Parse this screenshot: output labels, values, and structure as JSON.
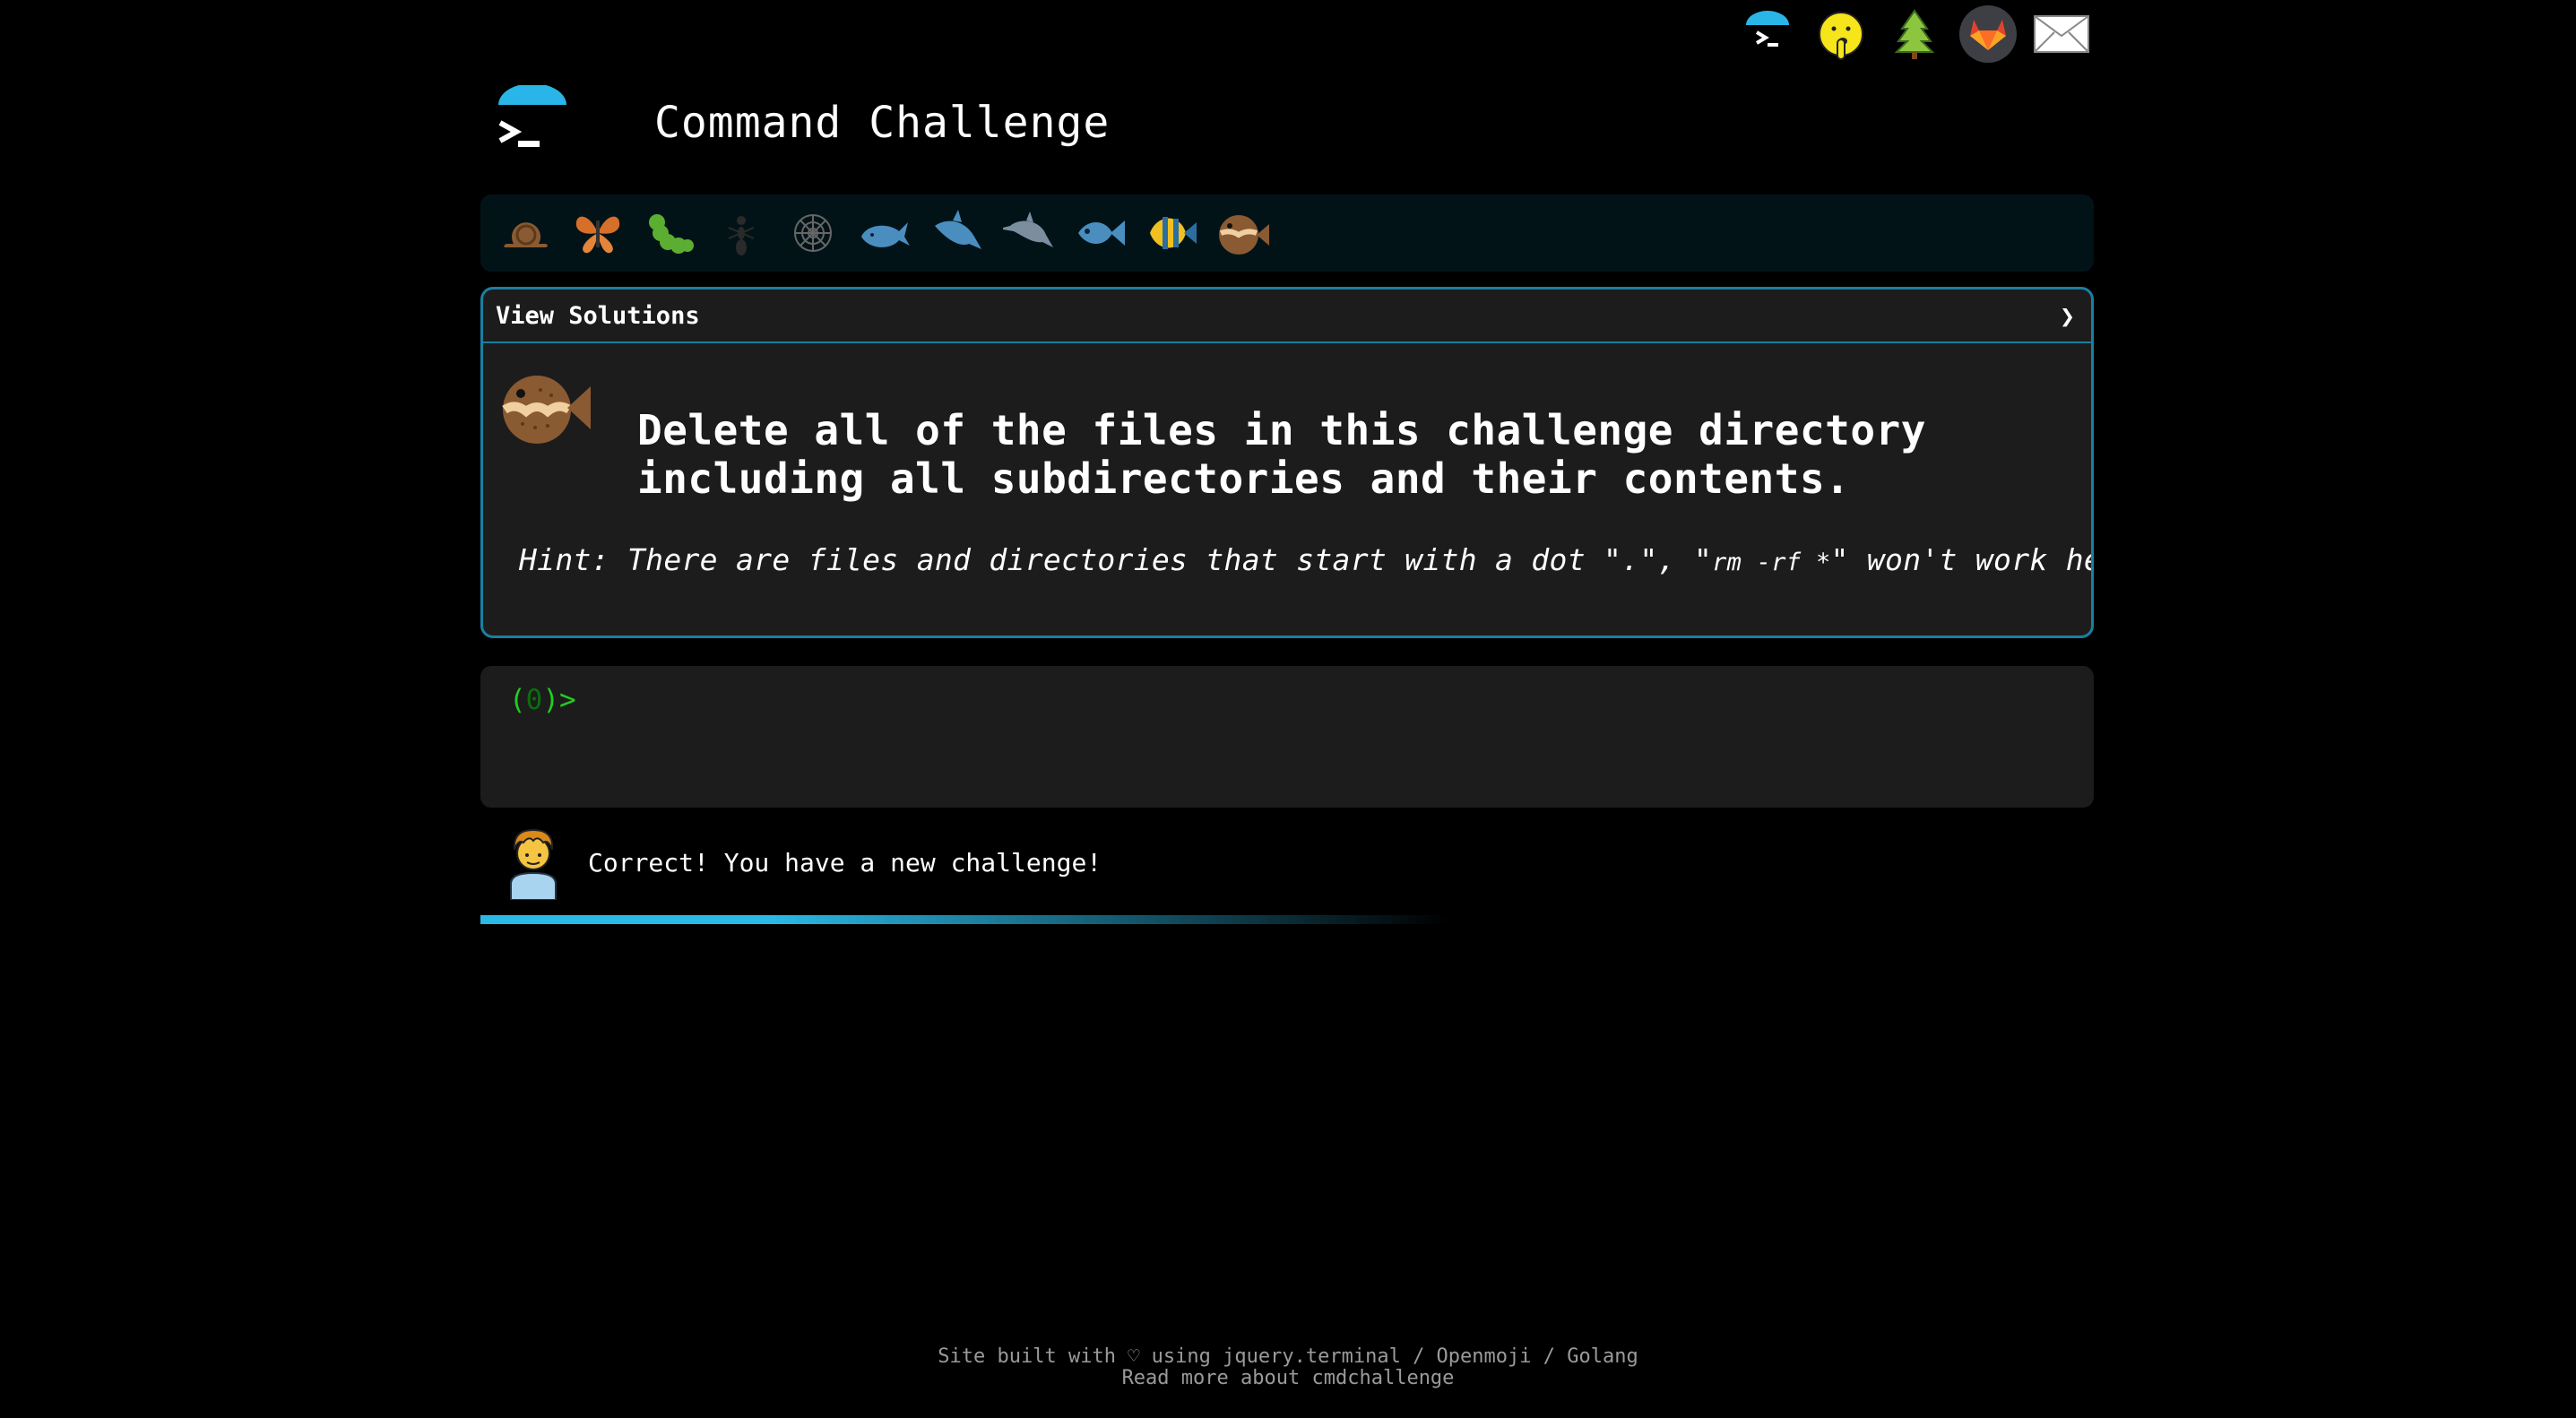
{
  "header": {
    "title": "Command Challenge",
    "logo_icon": "terminal-prompt-icon"
  },
  "top_icons": [
    "terminal-prompt-icon",
    "shushing-face-icon",
    "tree-icon",
    "gitlab-icon",
    "envelope-icon"
  ],
  "levels": [
    "snail-icon",
    "butterfly-icon",
    "caterpillar-icon",
    "ant-icon",
    "spider-web-icon",
    "whale-icon",
    "shark-icon",
    "dolphin-icon",
    "fish-icon",
    "tropical-fish-icon",
    "blowfish-icon"
  ],
  "challenge": {
    "view_solutions_label": "View Solutions",
    "chevron": "❯",
    "task_line1": "Delete all of the files in this challenge directory",
    "task_line2": "including all subdirectories and their contents.",
    "hint_prefix": "Hint: There are files and directories that start with a dot \".\", \"",
    "hint_code": "rm -rf *",
    "hint_suffix": "\" won't work here!"
  },
  "terminal": {
    "prompt_open": "(",
    "prompt_count": "0",
    "prompt_close": ")>"
  },
  "message": {
    "text": "Correct! You have a new challenge!"
  },
  "footer": {
    "line1": "Site built with ♡ using jquery.terminal / Openmoji / Golang",
    "line2": "Read more about cmdchallenge"
  },
  "colors": {
    "accent": "#1b7fa2",
    "prompt_green": "#22cc22",
    "progress": "#2ab8e6"
  }
}
